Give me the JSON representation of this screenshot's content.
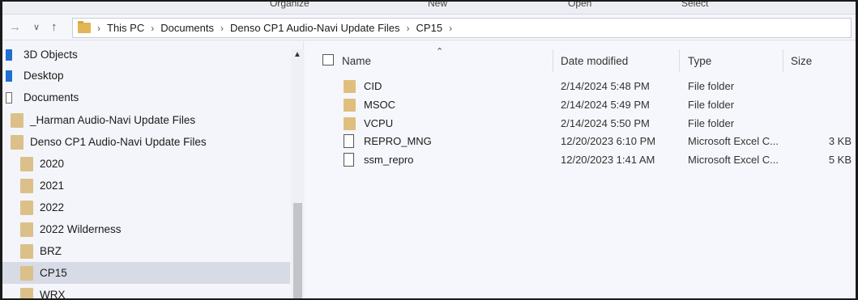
{
  "ribbon": {
    "groups": [
      "Organize",
      "New",
      "Open",
      "Select"
    ]
  },
  "nav": {
    "back_icon": "arrow-left",
    "forward_icon": "chevron-down",
    "up_icon": "arrow-up",
    "breadcrumbs": [
      "This PC",
      "Documents",
      "Denso CP1 Audio-Navi Update Files",
      "CP15"
    ]
  },
  "sidebar": {
    "items": [
      {
        "label": "3D Objects",
        "icon": "3d-objects-icon"
      },
      {
        "label": "Desktop",
        "icon": "desktop-icon"
      },
      {
        "label": "Documents",
        "icon": "documents-icon"
      },
      {
        "label": "_Harman Audio-Navi Update Files",
        "icon": "folder-icon"
      },
      {
        "label": "Denso CP1 Audio-Navi Update Files",
        "icon": "folder-icon"
      },
      {
        "label": "2020",
        "icon": "folder-icon"
      },
      {
        "label": "2021",
        "icon": "folder-icon"
      },
      {
        "label": "2022",
        "icon": "folder-icon"
      },
      {
        "label": "2022 Wilderness",
        "icon": "folder-icon"
      },
      {
        "label": "BRZ",
        "icon": "folder-icon"
      },
      {
        "label": "CP15",
        "icon": "folder-icon"
      },
      {
        "label": "WRX",
        "icon": "folder-icon"
      }
    ],
    "selected": "CP15"
  },
  "columns": {
    "name": "Name",
    "date": "Date modified",
    "type": "Type",
    "size": "Size"
  },
  "files": [
    {
      "name": "CID",
      "date": "2/14/2024 5:48 PM",
      "type": "File folder",
      "size": "",
      "kind": "folder"
    },
    {
      "name": "MSOC",
      "date": "2/14/2024 5:49 PM",
      "type": "File folder",
      "size": "",
      "kind": "folder"
    },
    {
      "name": "VCPU",
      "date": "2/14/2024 5:50 PM",
      "type": "File folder",
      "size": "",
      "kind": "folder"
    },
    {
      "name": "REPRO_MNG",
      "date": "12/20/2023 6:10 PM",
      "type": "Microsoft Excel C...",
      "size": "3 KB",
      "kind": "file"
    },
    {
      "name": "ssm_repro",
      "date": "12/20/2023 1:41 AM",
      "type": "Microsoft Excel C...",
      "size": "5 KB",
      "kind": "file"
    }
  ],
  "colors": {
    "folder": "#dfbf7e",
    "selection": "#d7dbe6",
    "accent_blue": "#1e6fd0"
  }
}
